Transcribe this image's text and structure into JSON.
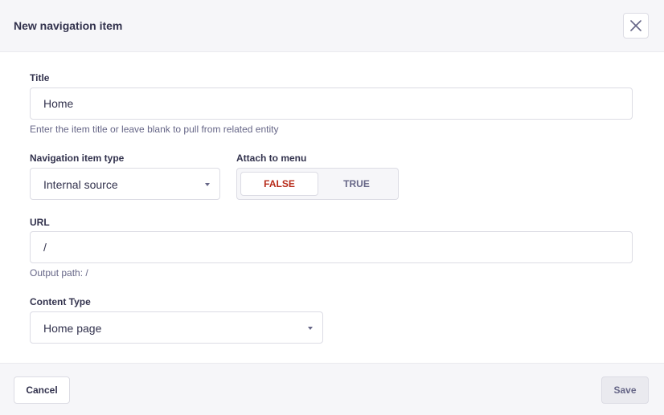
{
  "header": {
    "title": "New navigation item",
    "close_icon": "close-icon"
  },
  "fields": {
    "title": {
      "label": "Title",
      "value": "Home",
      "hint": "Enter the item title or leave blank to pull from related entity"
    },
    "nav_type": {
      "label": "Navigation item type",
      "value": "Internal source",
      "icon": "chevron-down-icon"
    },
    "attach_menu": {
      "label": "Attach to menu",
      "false_label": "FALSE",
      "true_label": "TRUE",
      "selected": "FALSE"
    },
    "url": {
      "label": "URL",
      "value": "/",
      "hint": "Output path: /"
    },
    "content_type": {
      "label": "Content Type",
      "value": "Home page",
      "icon": "chevron-down-icon"
    }
  },
  "footer": {
    "cancel_label": "Cancel",
    "save_label": "Save"
  },
  "colors": {
    "header_bg": "#f6f6f9",
    "border": "#dcdce4",
    "text": "#32324d",
    "muted": "#666687",
    "false_active": "#b72b1a"
  }
}
